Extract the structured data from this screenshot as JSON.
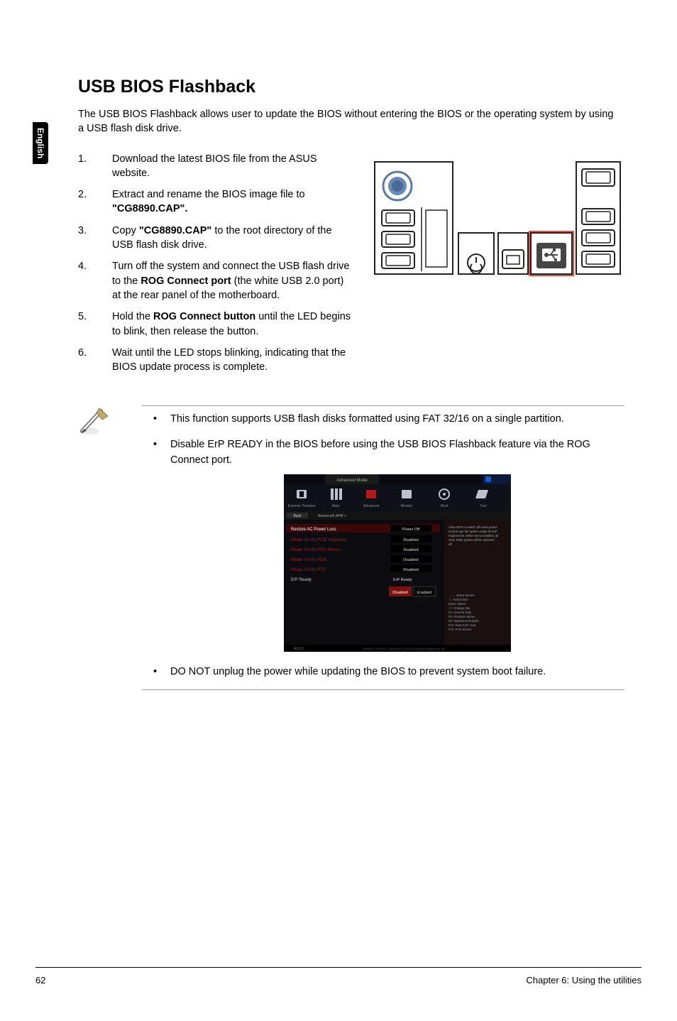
{
  "sideTab": "English",
  "heading": "USB BIOS Flashback",
  "intro": "The USB BIOS Flashback allows user to update the BIOS without entering the BIOS or the operating system by using a USB flash disk drive.",
  "steps": [
    {
      "num": "1.",
      "text_before": "Download the latest BIOS file from the ASUS website.",
      "bold": "",
      "text_after": ""
    },
    {
      "num": "2.",
      "text_before": "Extract and rename the BIOS image file to ",
      "bold": "\"CG8890.CAP\".",
      "text_after": ""
    },
    {
      "num": "3.",
      "text_before": "Copy ",
      "bold": "\"CG8890.CAP\"",
      "text_after": " to the root directory of the USB flash disk drive."
    },
    {
      "num": "4.",
      "text_before": "Turn off the system and connect the USB flash drive to the ",
      "bold": "ROG Connect port",
      "text_after": " (the white USB 2.0 port) at the rear panel of the motherboard."
    },
    {
      "num": "5.",
      "text_before": "Hold the ",
      "bold": "ROG Connect button",
      "text_after": " until the LED begins to blink, then release the button."
    },
    {
      "num": "6.",
      "text_before": "Wait until the LED stops blinking, indicating that the BIOS update process is complete.",
      "bold": "",
      "text_after": ""
    }
  ],
  "notes": [
    "This function supports USB flash disks formatted using FAT 32/16 on a single partition.",
    "Disable ErP READY in the BIOS before using the USB BIOS Flashback feature via the ROG Connect port.",
    "DO NOT unplug the power while updating the BIOS to prevent system boot failure."
  ],
  "footer": {
    "page": "62",
    "chapter": "Chapter 6: Using the utilities"
  }
}
